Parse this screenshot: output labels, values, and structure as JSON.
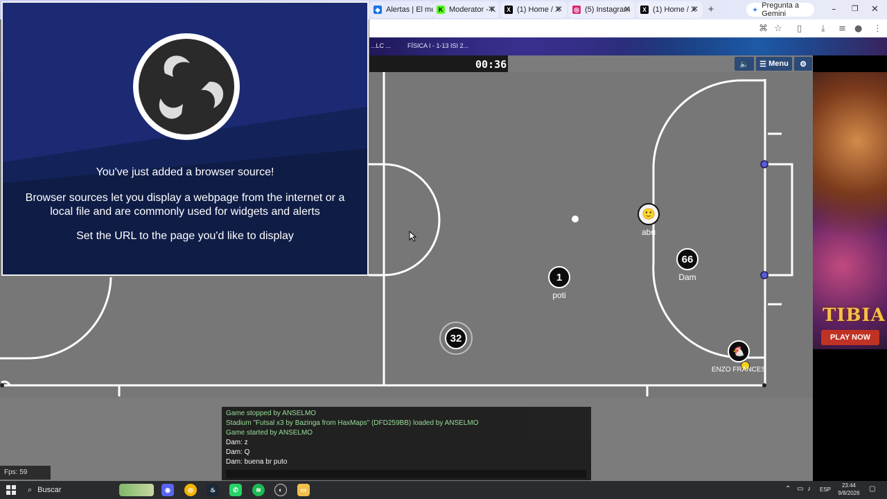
{
  "browser": {
    "tabs": [
      {
        "title": "Alertas | El me",
        "favicon": "alert-icon",
        "color": "#1a73e8"
      },
      {
        "title": "Moderator - K",
        "favicon": "kick-icon",
        "color": "#53fc18"
      },
      {
        "title": "(1) Home / X",
        "favicon": "x-icon",
        "color": "#000000"
      },
      {
        "title": "(5) Instagram",
        "favicon": "instagram-icon",
        "color": "#d62976"
      },
      {
        "title": "(1) Home / X",
        "favicon": "x-icon",
        "color": "#000000"
      }
    ],
    "new_tab": "+",
    "gemini_button": "Pregunta a Gemini",
    "bookmark_lead": "...LC ...",
    "bookmark": "FÍSICA I - 1-13 ISI 2..."
  },
  "game": {
    "timer": "00:36",
    "menu_label": "Menu",
    "sound_icon": "speaker-icon",
    "settings_icon": "gear-icon",
    "players": [
      {
        "number": "1",
        "name": "poti"
      },
      {
        "number": "66",
        "name": "Dam"
      },
      {
        "number": "32",
        "name": ""
      },
      {
        "number": "",
        "name": "abu",
        "avatar": "face"
      },
      {
        "number": "",
        "name": "ENZO FRANCES",
        "avatar": "chicken"
      }
    ],
    "fps": "Fps: 59"
  },
  "ad": {
    "brand": "TIBIA",
    "cta": "PLAY NOW"
  },
  "obs": {
    "title": "You've just added a browser source!",
    "body": "Browser sources let you display a webpage from the internet or a local file and are commonly used for widgets and alerts",
    "instruction": "Set the URL to the page you'd like to display"
  },
  "chat": {
    "messages": [
      {
        "text": "Game stopped by ANSELMO",
        "color": "#9be39b"
      },
      {
        "text": "Stadium \"Futsal x3 by Bazinga from HaxMaps\" (DFD259BB) loaded by ANSELMO",
        "color": "#9be39b"
      },
      {
        "text": "Game started by ANSELMO",
        "color": "#9be39b"
      },
      {
        "text": "Dam: z",
        "color": "#ffffff"
      },
      {
        "text": "Dam: Q",
        "color": "#ffffff"
      },
      {
        "text": "Dam: buena br puto",
        "color": "#ffffff"
      }
    ]
  },
  "taskbar": {
    "search_label": "Buscar",
    "lang": "ESP",
    "time": "23:44",
    "date": "9/8/2026"
  }
}
